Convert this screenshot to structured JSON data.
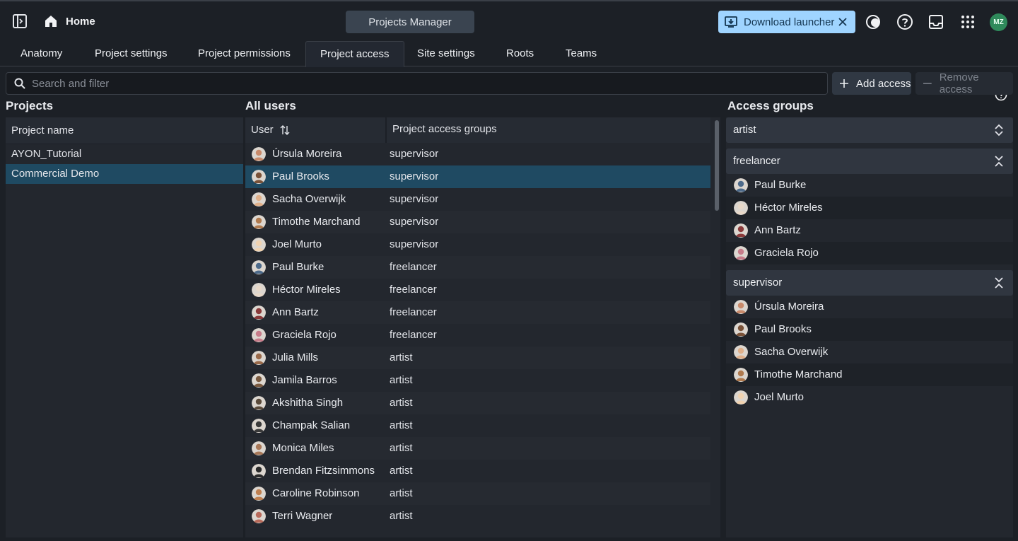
{
  "header": {
    "home_label": "Home",
    "center_pill": "Projects Manager",
    "launcher_label": "Download launcher",
    "user_initials": "MZ",
    "accent_color": "#9fd4ff",
    "avatar_color": "#2f8a5b"
  },
  "tabs": [
    {
      "label": "Anatomy"
    },
    {
      "label": "Project settings"
    },
    {
      "label": "Project permissions"
    },
    {
      "label": "Project access",
      "active": true
    },
    {
      "label": "Site settings"
    },
    {
      "label": "Roots"
    },
    {
      "label": "Teams"
    }
  ],
  "toolbar": {
    "search_placeholder": "Search and filter",
    "add_label": "Add access",
    "remove_label": "Remove access"
  },
  "projects": {
    "title": "Projects",
    "column": "Project name",
    "items": [
      "AYON_Tutorial",
      "Commercial Demo"
    ],
    "selected": "Commercial Demo"
  },
  "users": {
    "title": "All users",
    "col_user": "User",
    "col_groups": "Project access groups",
    "rows": [
      {
        "name": "Úrsula Moreira",
        "group": "supervisor"
      },
      {
        "name": "Paul Brooks",
        "group": "supervisor",
        "selected": true
      },
      {
        "name": "Sacha Overwijk",
        "group": "supervisor"
      },
      {
        "name": "Timothe Marchand",
        "group": "supervisor"
      },
      {
        "name": "Joel Murto",
        "group": "supervisor"
      },
      {
        "name": "Paul Burke",
        "group": "freelancer"
      },
      {
        "name": "Héctor Mireles",
        "group": "freelancer"
      },
      {
        "name": "Ann Bartz",
        "group": "freelancer"
      },
      {
        "name": "Graciela Rojo",
        "group": "freelancer"
      },
      {
        "name": "Julia Mills",
        "group": "artist"
      },
      {
        "name": "Jamila Barros",
        "group": "artist"
      },
      {
        "name": "Akshitha Singh",
        "group": "artist"
      },
      {
        "name": "Champak Salian",
        "group": "artist"
      },
      {
        "name": "Monica Miles",
        "group": "artist"
      },
      {
        "name": "Brendan Fitzsimmons",
        "group": "artist"
      },
      {
        "name": "Caroline Robinson",
        "group": "artist"
      },
      {
        "name": "Terri Wagner",
        "group": "artist"
      }
    ]
  },
  "access_groups": {
    "title": "Access groups",
    "groups": [
      {
        "name": "artist",
        "expanded": false,
        "members": []
      },
      {
        "name": "freelancer",
        "expanded": true,
        "members": [
          "Paul Burke",
          "Héctor Mireles",
          "Ann Bartz",
          "Graciela Rojo"
        ]
      },
      {
        "name": "supervisor",
        "expanded": true,
        "members": [
          "Úrsula Moreira",
          "Paul Brooks",
          "Sacha Overwijk",
          "Timothe Marchand",
          "Joel Murto"
        ]
      }
    ]
  }
}
